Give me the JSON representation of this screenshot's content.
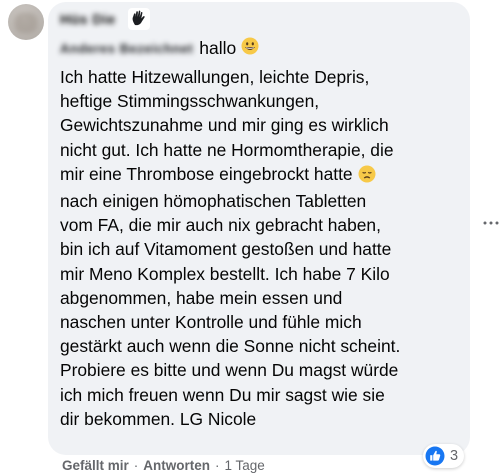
{
  "author": {
    "name_blurred": "Hüs Die",
    "tagged_blurred": "Anderes Bezeichnet"
  },
  "comment": {
    "greeting": "hallo",
    "lines": [
      "Ich hatte Hitzewallungen, leichte Depris,",
      "heftige Stimmingsschwankungen,",
      "Gewichtszunahme und mir ging es wirklich",
      "nicht gut. Ich hatte ne Hormomtherapie, die",
      "mir eine Thrombose eingebrockt hatte",
      "nach einigen hömophatischen Tabletten",
      "vom FA, die mir auch nix gebracht haben,",
      "bin ich auf Vitamoment gestoßen und hatte",
      "mir Meno Komplex bestellt. Ich habe 7 Kilo",
      "abgenommen, habe mein essen und",
      "naschen unter Kontrolle und fühle mich",
      "gestärkt auch wenn die Sonne nicht scheint.",
      "Probiere es bitte und wenn Du magst würde",
      "ich mich freuen wenn Du mir sagst wie sie",
      "dir bekommen. LG Nicole"
    ]
  },
  "reactions": {
    "count": "3",
    "icon": "like-icon",
    "color": "#1877f2"
  },
  "actions": {
    "like": "Gefällt mir",
    "separator": "·",
    "reply": "Antworten",
    "time": "1 Tage"
  },
  "colors": {
    "bubble": "#f0f2f5",
    "text": "#050505",
    "secondary": "#65676b",
    "emoji": "#f7c948"
  }
}
